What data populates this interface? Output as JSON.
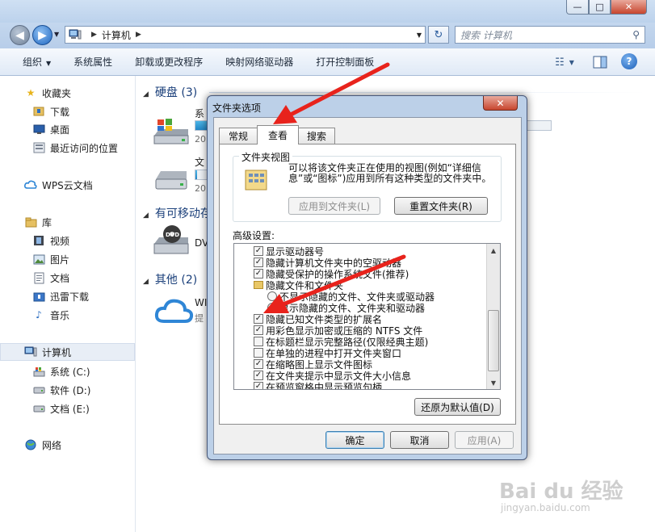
{
  "window": {
    "controls": {
      "minimize": "—",
      "maximize": "□",
      "close": "✕"
    }
  },
  "nav": {
    "back": "◀",
    "forward": "▶",
    "history_drop": "▼",
    "address_segments": [
      "计算机"
    ],
    "address_drop": "▼",
    "refresh": "↻",
    "search_placeholder": "搜索 计算机",
    "search_icon": "search-icon"
  },
  "toolbar": {
    "organize": "组织",
    "system_properties": "系统属性",
    "uninstall": "卸载或更改程序",
    "map_drive": "映射网络驱动器",
    "control_panel": "打开控制面板"
  },
  "sidebar": {
    "favorites": "收藏夹",
    "downloads": "下载",
    "desktop": "桌面",
    "recent": "最近访问的位置",
    "wps": "WPS云文档",
    "library": "库",
    "videos": "视频",
    "pictures": "图片",
    "documents": "文档",
    "xunlei": "迅雷下载",
    "music": "音乐",
    "computer": "计算机",
    "drive_c": "系统 (C:)",
    "drive_d": "软件 (D:)",
    "drive_e": "文档 (E:)",
    "network": "网络"
  },
  "main": {
    "hard_disks": "硬盘 (3)",
    "removable": "有可移动存",
    "other": "其他 (2)",
    "drives": [
      {
        "name": "系",
        "sub": "20",
        "fill_percent": 30
      },
      {
        "name": "文",
        "sub": "20",
        "fill_percent": 10
      }
    ],
    "dvd": "DV",
    "wps_item": "WI",
    "wps_sub": "提"
  },
  "dialog": {
    "title": "文件夹选项",
    "close": "✕",
    "tabs": [
      "常规",
      "查看",
      "搜索"
    ],
    "active_tab": 1,
    "folder_views": {
      "legend": "文件夹视图",
      "description": "可以将该文件夹正在使用的视图(例如“详细信息”或“图标”)应用到所有这种类型的文件夹中。",
      "apply_button": "应用到文件夹(L)",
      "reset_button": "重置文件夹(R)"
    },
    "advanced_label": "高级设置:",
    "advanced_items": [
      {
        "kind": "check",
        "checked": true,
        "label": "显示驱动器号",
        "indent": 0
      },
      {
        "kind": "check",
        "checked": true,
        "label": "隐藏计算机文件夹中的空驱动器",
        "indent": 0
      },
      {
        "kind": "check",
        "checked": true,
        "label": "隐藏受保护的操作系统文件(推荐)",
        "indent": 0
      },
      {
        "kind": "folder",
        "checked": false,
        "label": "隐藏文件和文件夹",
        "indent": 0
      },
      {
        "kind": "radio",
        "checked": false,
        "label": "不显示隐藏的文件、文件夹或驱动器",
        "indent": 1
      },
      {
        "kind": "radio",
        "checked": false,
        "label": "显示隐藏的文件、文件夹和驱动器",
        "indent": 1
      },
      {
        "kind": "check",
        "checked": true,
        "label": "隐藏已知文件类型的扩展名",
        "indent": 0
      },
      {
        "kind": "check",
        "checked": true,
        "label": "用彩色显示加密或压缩的 NTFS 文件",
        "indent": 0
      },
      {
        "kind": "check",
        "checked": false,
        "label": "在标题栏显示完整路径(仅限经典主题)",
        "indent": 0
      },
      {
        "kind": "check",
        "checked": false,
        "label": "在单独的进程中打开文件夹窗口",
        "indent": 0
      },
      {
        "kind": "check",
        "checked": true,
        "label": "在缩略图上显示文件图标",
        "indent": 0
      },
      {
        "kind": "check",
        "checked": true,
        "label": "在文件夹提示中显示文件大小信息",
        "indent": 0
      },
      {
        "kind": "check",
        "checked": true,
        "label": "在预览窗格中显示预览句柄",
        "indent": 0
      }
    ],
    "restore_defaults": "还原为默认值(D)",
    "ok": "确定",
    "cancel": "取消",
    "apply": "应用(A)",
    "scroll_up": "▲",
    "scroll_down": "▼"
  },
  "watermark": {
    "logo": "Bai du 经验",
    "url": "jingyan.baidu.com"
  }
}
